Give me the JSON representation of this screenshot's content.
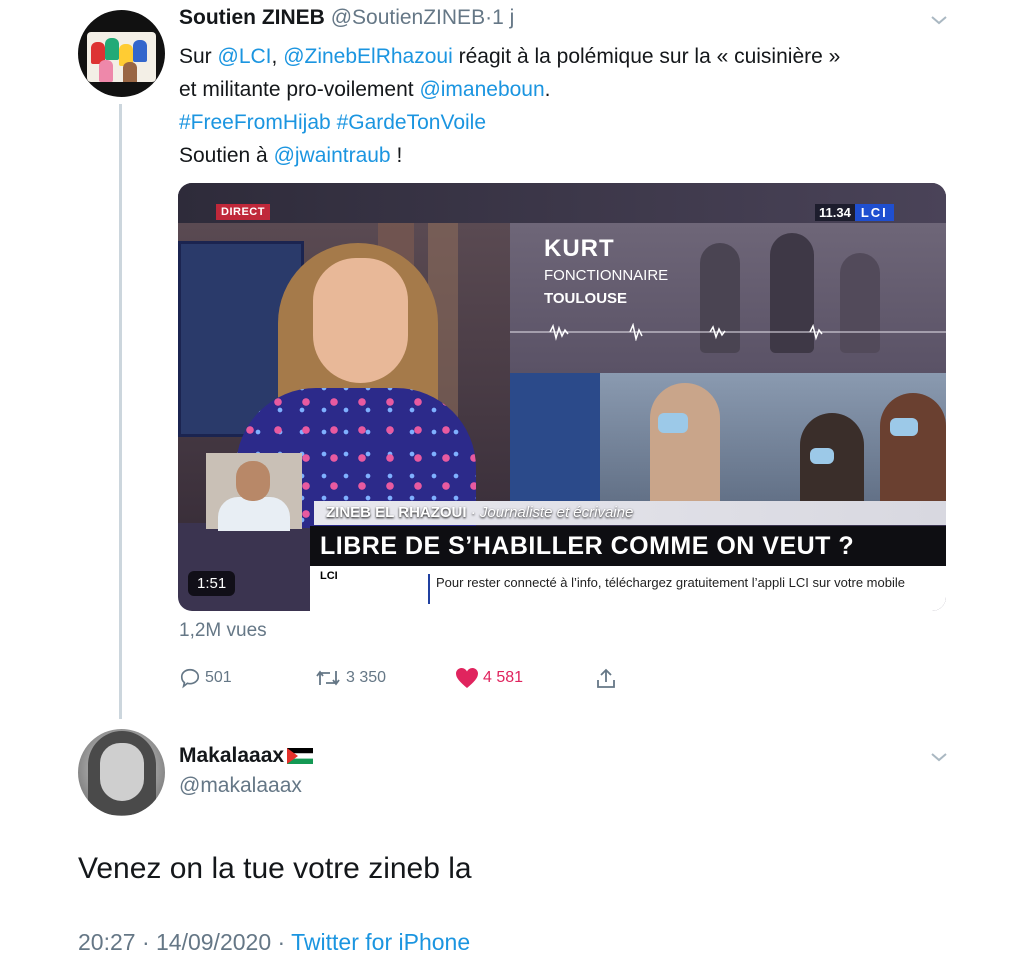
{
  "tweet1": {
    "display_name": "Soutien ZINEB",
    "handle": "@SoutienZINEB",
    "separator": "·",
    "age": "1 j",
    "body": [
      [
        {
          "t": "Sur ",
          "link": false
        },
        {
          "t": "@LCI",
          "link": true
        },
        {
          "t": ", ",
          "link": false
        },
        {
          "t": "@ZinebElRhazoui",
          "link": true
        },
        {
          "t": " réagit à la polémique sur la « cuisinière »",
          "link": false
        }
      ],
      [
        {
          "t": "et militante pro-voilement ",
          "link": false
        },
        {
          "t": "@imaneboun",
          "link": true
        },
        {
          "t": ".",
          "link": false
        }
      ],
      [
        {
          "t": "#FreeFromHijab",
          "link": true
        },
        {
          "t": " ",
          "link": false
        },
        {
          "t": "#GardeTonVoile",
          "link": true
        }
      ],
      [
        {
          "t": "Soutien à ",
          "link": false
        },
        {
          "t": "@jwaintraub",
          "link": true
        },
        {
          "t": " !",
          "link": false
        }
      ]
    ],
    "video": {
      "live_badge": "DIRECT",
      "clock": "11.34",
      "channel": "LCI",
      "guest_name": "KURT",
      "guest_job": "FONCTIONNAIRE",
      "guest_city": "TOULOUSE",
      "speaker_name": "ZINEB EL RHAZOUI",
      "speaker_title": " · Journaliste et écrivaine",
      "headline": "LIBRE DE S’HABILLER COMME ON VEUT ?",
      "ticker_logo": "LCI",
      "ticker_text": "Pour rester connecté à l’info, téléchargez gratuitement l’appli LCI sur votre mobile",
      "duration": "1:51"
    },
    "views": "1,2M vues",
    "actions": {
      "replies": "501",
      "retweets": "3 350",
      "likes": "4 581"
    },
    "colors": {
      "link": "#1b95e0",
      "like": "#e0245e",
      "secondary": "#657786"
    }
  },
  "tweet2": {
    "display_name": "Makalaaax",
    "flag_icon": "palestine-flag-icon",
    "handle": "@makalaaax",
    "text": "Venez on la tue votre zineb la",
    "timestamp": "20:27 · 14/09/2020 · ",
    "source": "Twitter for iPhone"
  }
}
